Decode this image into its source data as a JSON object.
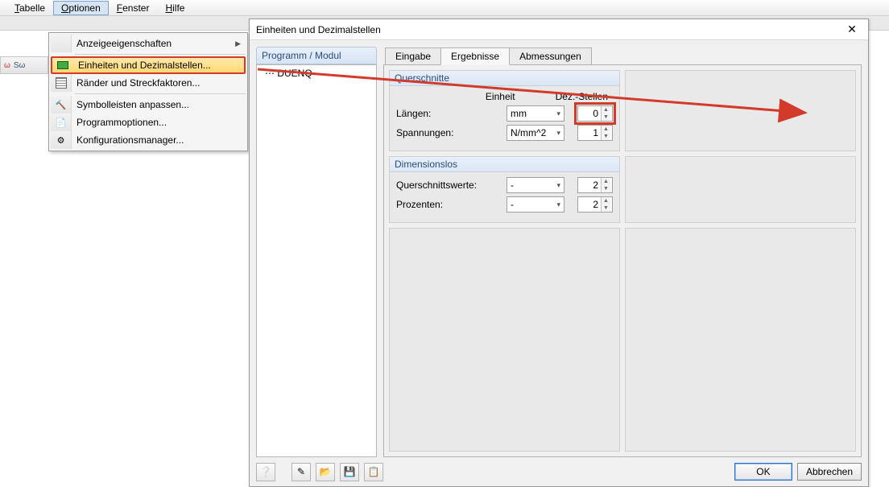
{
  "menubar": {
    "items": [
      {
        "label": "Tabelle",
        "mn": "T"
      },
      {
        "label": "Optionen",
        "mn": "O"
      },
      {
        "label": "Fenster",
        "mn": "F"
      },
      {
        "label": "Hilfe",
        "mn": "H"
      }
    ]
  },
  "dropdown": {
    "items": [
      {
        "label": "Anzeigeeigenschaften",
        "submenu": true,
        "icon": ""
      },
      {
        "label": "Einheiten und Dezimalstellen...",
        "highlight": true,
        "icon": "ruler"
      },
      {
        "label": "Ränder und Streckfaktoren...",
        "icon": "grid"
      },
      {
        "label": "Symbolleisten anpassen...",
        "icon": "tool"
      },
      {
        "label": "Programmoptionen...",
        "icon": "gear-doc"
      },
      {
        "label": "Konfigurationsmanager...",
        "icon": "cfg"
      }
    ]
  },
  "mini_toolbar": {
    "a": "ω",
    "b": "Sω"
  },
  "dialog": {
    "title": "Einheiten und Dezimalstellen",
    "left_header": "Programm / Modul",
    "tree_item": "DUENQ",
    "tabs": [
      "Eingabe",
      "Ergebnisse",
      "Abmessungen"
    ],
    "group_querschnitte": {
      "title": "Querschnitte",
      "col_einheit": "Einheit",
      "col_dez": "Dez.-Stellen",
      "rows": [
        {
          "label": "Längen:",
          "unit": "mm",
          "dez": "0",
          "red": true
        },
        {
          "label": "Spannungen:",
          "unit": "N/mm^2",
          "dez": "1"
        }
      ]
    },
    "group_dimensionslos": {
      "title": "Dimensionslos",
      "rows": [
        {
          "label": "Querschnittswerte:",
          "unit": "-",
          "dez": "2"
        },
        {
          "label": "Prozenten:",
          "unit": "-",
          "dez": "2"
        }
      ]
    },
    "buttons": {
      "ok": "OK",
      "cancel": "Abbrechen"
    }
  }
}
